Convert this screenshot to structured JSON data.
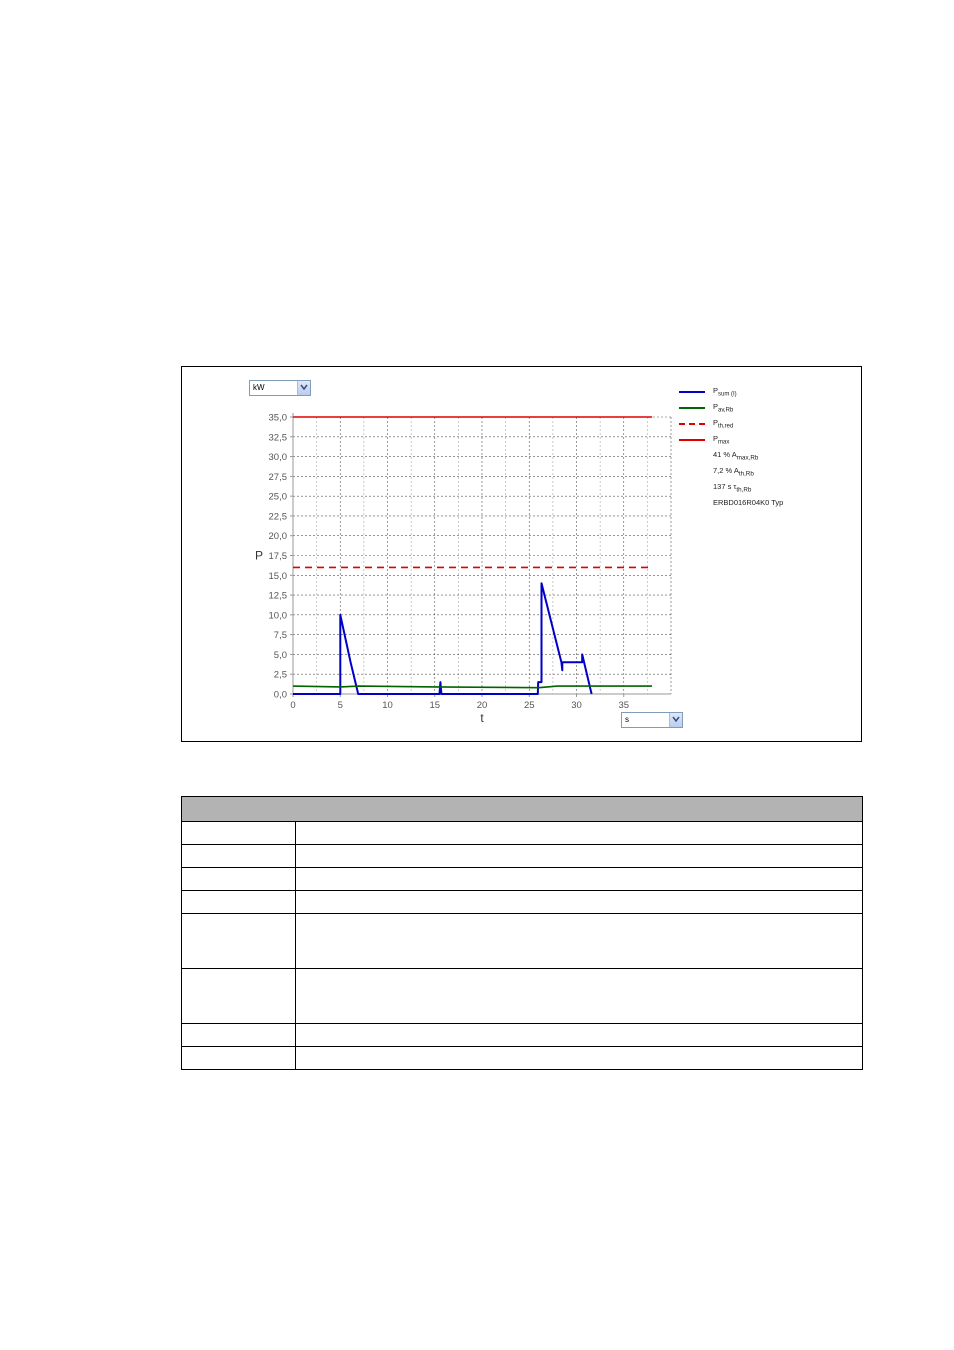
{
  "y_unit_select": {
    "selected": "kW"
  },
  "x_unit_select": {
    "selected": "s"
  },
  "chart_data": {
    "type": "line",
    "xlabel": "t",
    "ylabel": "P",
    "xlim": [
      0,
      40
    ],
    "ylim": [
      0,
      35
    ],
    "x_ticks": [
      "0",
      "5",
      "10",
      "15",
      "20",
      "25",
      "30",
      "35"
    ],
    "x_tick_values": [
      0,
      5,
      10,
      15,
      20,
      25,
      30,
      35
    ],
    "y_ticks": [
      "0,0",
      "2,5",
      "5,0",
      "7,5",
      "10,0",
      "12,5",
      "15,0",
      "17,5",
      "20,0",
      "22,5",
      "25,0",
      "27,5",
      "30,0",
      "32,5",
      "35,0"
    ],
    "y_tick_values": [
      0,
      2.5,
      5,
      7.5,
      10,
      12.5,
      15,
      17.5,
      20,
      22.5,
      25,
      27.5,
      30,
      32.5,
      35
    ],
    "grid": true,
    "legend_position": "right",
    "series": [
      {
        "label": "P",
        "sub": "sum (I)",
        "color": "#0000c8",
        "dash": false,
        "points": [
          [
            0,
            0
          ],
          [
            5,
            0
          ],
          [
            5,
            10
          ],
          [
            6.1,
            4
          ],
          [
            6.9,
            0
          ],
          [
            15.5,
            0
          ],
          [
            15.6,
            1.5
          ],
          [
            15.7,
            0
          ],
          [
            15.95,
            0
          ],
          [
            25.9,
            0
          ],
          [
            25.95,
            1.5
          ],
          [
            26.3,
            1.5
          ],
          [
            26.3,
            14
          ],
          [
            28.4,
            4
          ],
          [
            28.5,
            3
          ],
          [
            28.5,
            4
          ],
          [
            30.6,
            4
          ],
          [
            30.6,
            5
          ],
          [
            31.6,
            0
          ]
        ]
      },
      {
        "label": "P",
        "sub": "av,Rb",
        "color": "#006400",
        "dash": false,
        "points": [
          [
            0,
            1
          ],
          [
            5,
            0.9
          ],
          [
            7,
            1
          ],
          [
            15,
            0.9
          ],
          [
            26,
            0.8
          ],
          [
            28,
            1
          ],
          [
            38,
            1
          ]
        ]
      },
      {
        "label": "P",
        "sub": "th,red",
        "color": "#e00000",
        "dash": true,
        "points": [
          [
            0,
            16
          ],
          [
            38,
            16
          ]
        ]
      },
      {
        "label": "P",
        "sub": "max",
        "color": "#e00000",
        "dash": false,
        "points": [
          [
            0,
            35
          ],
          [
            38,
            35
          ]
        ]
      }
    ],
    "info": [
      {
        "value": "41 %",
        "label": "A",
        "sub": "max,Rb"
      },
      {
        "value": "7,2 %",
        "label": "A",
        "sub": "th,Rb"
      },
      {
        "value": "137 s",
        "label": "τ",
        "sub": "th,Rb"
      },
      {
        "value": "ERBD016R04K0",
        "label": "Typ",
        "sub": ""
      }
    ]
  },
  "table": {
    "header": "",
    "rows": [
      {
        "c1": "",
        "c2": "",
        "tall": false
      },
      {
        "c1": "",
        "c2": "",
        "tall": false
      },
      {
        "c1": "",
        "c2": "",
        "tall": false
      },
      {
        "c1": "",
        "c2": "",
        "tall": false
      },
      {
        "c1": "",
        "c2": "",
        "tall": true
      },
      {
        "c1": "",
        "c2": "",
        "tall": true
      },
      {
        "c1": "",
        "c2": "",
        "tall": false
      },
      {
        "c1": "",
        "c2": "",
        "tall": false
      }
    ]
  }
}
